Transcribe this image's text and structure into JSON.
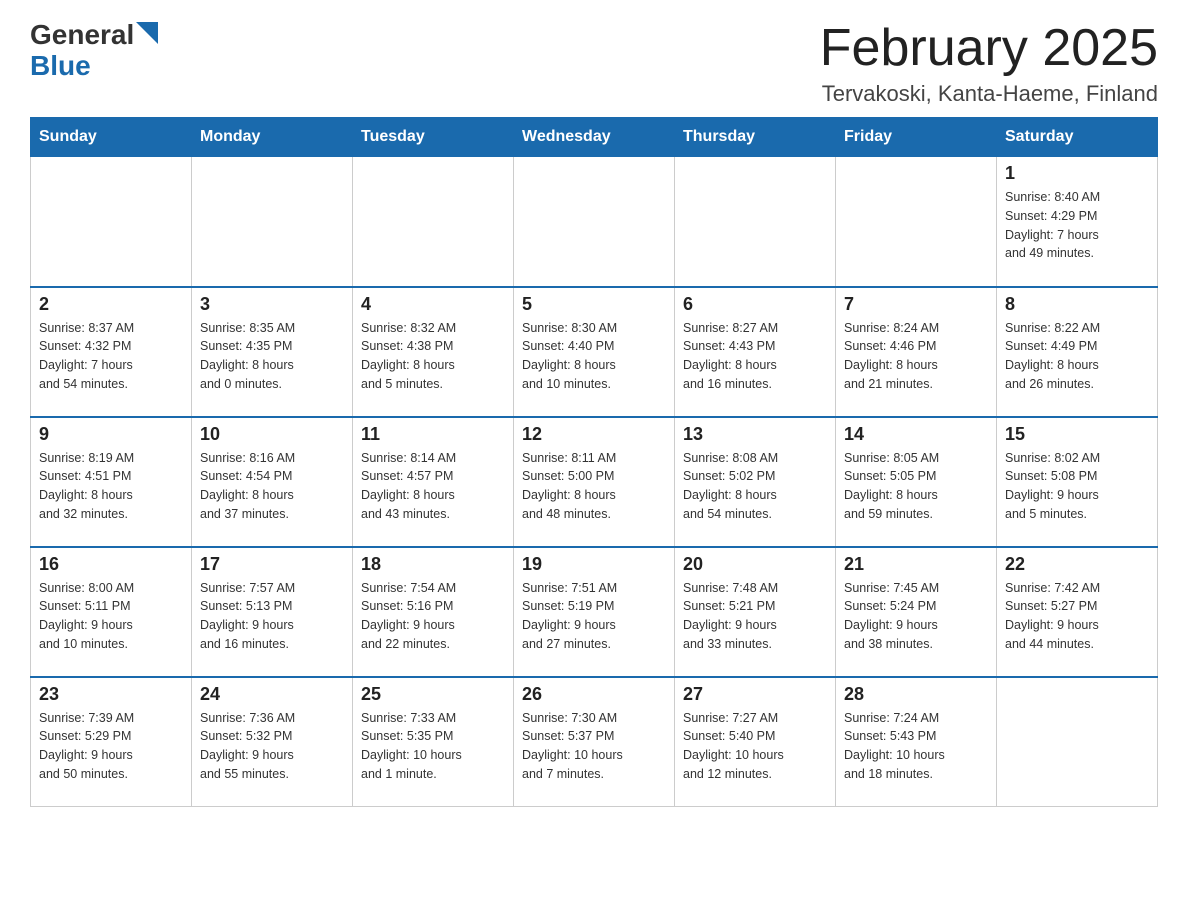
{
  "logo": {
    "general": "General",
    "blue": "Blue"
  },
  "title": "February 2025",
  "subtitle": "Tervakoski, Kanta-Haeme, Finland",
  "headers": [
    "Sunday",
    "Monday",
    "Tuesday",
    "Wednesday",
    "Thursday",
    "Friday",
    "Saturday"
  ],
  "weeks": [
    [
      {
        "day": "",
        "info": ""
      },
      {
        "day": "",
        "info": ""
      },
      {
        "day": "",
        "info": ""
      },
      {
        "day": "",
        "info": ""
      },
      {
        "day": "",
        "info": ""
      },
      {
        "day": "",
        "info": ""
      },
      {
        "day": "1",
        "info": "Sunrise: 8:40 AM\nSunset: 4:29 PM\nDaylight: 7 hours\nand 49 minutes."
      }
    ],
    [
      {
        "day": "2",
        "info": "Sunrise: 8:37 AM\nSunset: 4:32 PM\nDaylight: 7 hours\nand 54 minutes."
      },
      {
        "day": "3",
        "info": "Sunrise: 8:35 AM\nSunset: 4:35 PM\nDaylight: 8 hours\nand 0 minutes."
      },
      {
        "day": "4",
        "info": "Sunrise: 8:32 AM\nSunset: 4:38 PM\nDaylight: 8 hours\nand 5 minutes."
      },
      {
        "day": "5",
        "info": "Sunrise: 8:30 AM\nSunset: 4:40 PM\nDaylight: 8 hours\nand 10 minutes."
      },
      {
        "day": "6",
        "info": "Sunrise: 8:27 AM\nSunset: 4:43 PM\nDaylight: 8 hours\nand 16 minutes."
      },
      {
        "day": "7",
        "info": "Sunrise: 8:24 AM\nSunset: 4:46 PM\nDaylight: 8 hours\nand 21 minutes."
      },
      {
        "day": "8",
        "info": "Sunrise: 8:22 AM\nSunset: 4:49 PM\nDaylight: 8 hours\nand 26 minutes."
      }
    ],
    [
      {
        "day": "9",
        "info": "Sunrise: 8:19 AM\nSunset: 4:51 PM\nDaylight: 8 hours\nand 32 minutes."
      },
      {
        "day": "10",
        "info": "Sunrise: 8:16 AM\nSunset: 4:54 PM\nDaylight: 8 hours\nand 37 minutes."
      },
      {
        "day": "11",
        "info": "Sunrise: 8:14 AM\nSunset: 4:57 PM\nDaylight: 8 hours\nand 43 minutes."
      },
      {
        "day": "12",
        "info": "Sunrise: 8:11 AM\nSunset: 5:00 PM\nDaylight: 8 hours\nand 48 minutes."
      },
      {
        "day": "13",
        "info": "Sunrise: 8:08 AM\nSunset: 5:02 PM\nDaylight: 8 hours\nand 54 minutes."
      },
      {
        "day": "14",
        "info": "Sunrise: 8:05 AM\nSunset: 5:05 PM\nDaylight: 8 hours\nand 59 minutes."
      },
      {
        "day": "15",
        "info": "Sunrise: 8:02 AM\nSunset: 5:08 PM\nDaylight: 9 hours\nand 5 minutes."
      }
    ],
    [
      {
        "day": "16",
        "info": "Sunrise: 8:00 AM\nSunset: 5:11 PM\nDaylight: 9 hours\nand 10 minutes."
      },
      {
        "day": "17",
        "info": "Sunrise: 7:57 AM\nSunset: 5:13 PM\nDaylight: 9 hours\nand 16 minutes."
      },
      {
        "day": "18",
        "info": "Sunrise: 7:54 AM\nSunset: 5:16 PM\nDaylight: 9 hours\nand 22 minutes."
      },
      {
        "day": "19",
        "info": "Sunrise: 7:51 AM\nSunset: 5:19 PM\nDaylight: 9 hours\nand 27 minutes."
      },
      {
        "day": "20",
        "info": "Sunrise: 7:48 AM\nSunset: 5:21 PM\nDaylight: 9 hours\nand 33 minutes."
      },
      {
        "day": "21",
        "info": "Sunrise: 7:45 AM\nSunset: 5:24 PM\nDaylight: 9 hours\nand 38 minutes."
      },
      {
        "day": "22",
        "info": "Sunrise: 7:42 AM\nSunset: 5:27 PM\nDaylight: 9 hours\nand 44 minutes."
      }
    ],
    [
      {
        "day": "23",
        "info": "Sunrise: 7:39 AM\nSunset: 5:29 PM\nDaylight: 9 hours\nand 50 minutes."
      },
      {
        "day": "24",
        "info": "Sunrise: 7:36 AM\nSunset: 5:32 PM\nDaylight: 9 hours\nand 55 minutes."
      },
      {
        "day": "25",
        "info": "Sunrise: 7:33 AM\nSunset: 5:35 PM\nDaylight: 10 hours\nand 1 minute."
      },
      {
        "day": "26",
        "info": "Sunrise: 7:30 AM\nSunset: 5:37 PM\nDaylight: 10 hours\nand 7 minutes."
      },
      {
        "day": "27",
        "info": "Sunrise: 7:27 AM\nSunset: 5:40 PM\nDaylight: 10 hours\nand 12 minutes."
      },
      {
        "day": "28",
        "info": "Sunrise: 7:24 AM\nSunset: 5:43 PM\nDaylight: 10 hours\nand 18 minutes."
      },
      {
        "day": "",
        "info": ""
      }
    ]
  ]
}
